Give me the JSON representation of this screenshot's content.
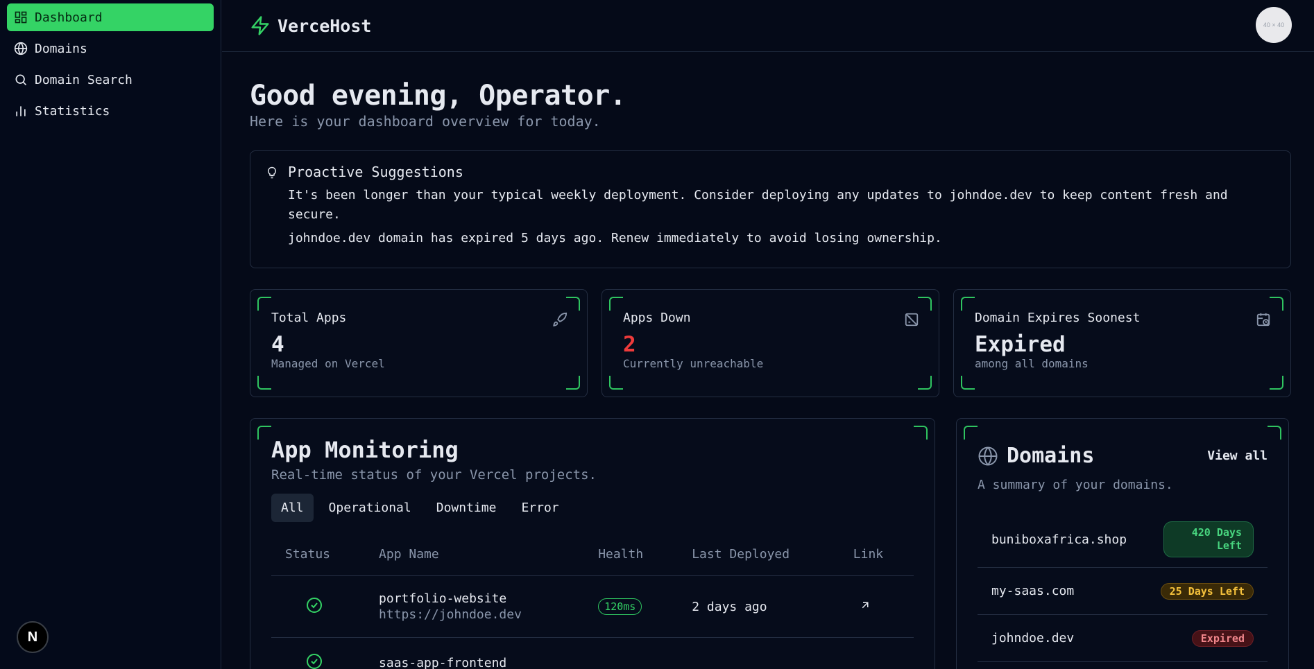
{
  "sidebar": {
    "items": [
      {
        "label": "Dashboard",
        "icon": "dashboard-icon",
        "active": true
      },
      {
        "label": "Domains",
        "icon": "globe-icon"
      },
      {
        "label": "Domain Search",
        "icon": "search-icon"
      },
      {
        "label": "Statistics",
        "icon": "bar-chart-icon"
      }
    ],
    "next_badge": "N"
  },
  "header": {
    "brand": "VerceHost",
    "avatar_placeholder": "40 × 40"
  },
  "main": {
    "greeting": "Good evening, Operator.",
    "subtitle": "Here is your dashboard overview for today.",
    "suggestions": {
      "title": "Proactive Suggestions",
      "items": [
        "It's been longer than your typical weekly deployment. Consider deploying any updates to johndoe.dev to keep content fresh and secure.",
        "johndoe.dev domain has expired 5 days ago. Renew immediately to avoid losing ownership."
      ]
    },
    "stats": [
      {
        "title": "Total Apps",
        "value": "4",
        "desc": "Managed on Vercel",
        "icon": "rocket-icon"
      },
      {
        "title": "Apps Down",
        "value": "2",
        "desc": "Currently unreachable",
        "icon": "server-off-icon",
        "color": "#ef3b3b"
      },
      {
        "title": "Domain Expires Soonest",
        "value": "Expired",
        "desc": "among all domains",
        "icon": "calendar-clock-icon"
      }
    ],
    "monitoring": {
      "title": "App Monitoring",
      "desc": "Real-time status of your Vercel projects.",
      "tabs": [
        "All",
        "Operational",
        "Downtime",
        "Error"
      ],
      "columns": [
        "Status",
        "App Name",
        "Health",
        "Last Deployed",
        "Link"
      ],
      "rows": [
        {
          "name": "portfolio-website",
          "url": "https://johndoe.dev",
          "health": "120ms",
          "deployed": "2 days ago"
        },
        {
          "name": "saas-app-frontend",
          "url": "",
          "health": "",
          "deployed": ""
        }
      ]
    },
    "domains": {
      "title": "Domains",
      "view_all": "View all",
      "desc": "A summary of your domains.",
      "items": [
        {
          "name": "buniboxafrica.shop",
          "badge": "420 Days Left",
          "tone": "green"
        },
        {
          "name": "my-saas.com",
          "badge": "25 Days Left",
          "tone": "yellow"
        },
        {
          "name": "johndoe.dev",
          "badge": "Expired",
          "tone": "red"
        }
      ]
    }
  },
  "colors": {
    "accent": "#34d365",
    "danger": "#ef3b3b",
    "background": "#050a18"
  }
}
